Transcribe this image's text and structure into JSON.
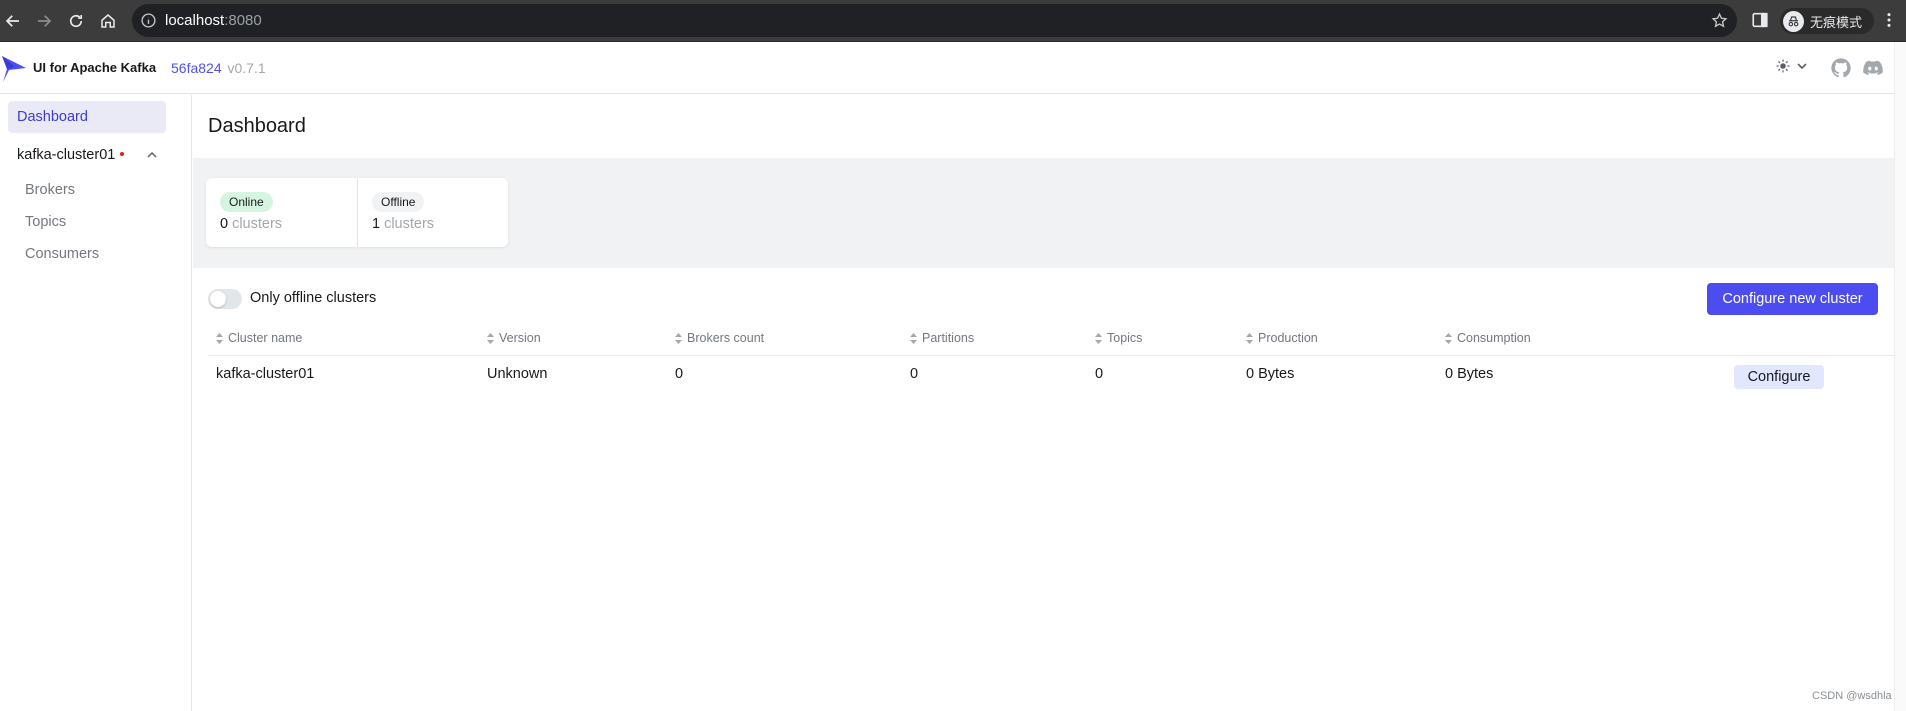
{
  "browser": {
    "url_host": "localhost",
    "url_port": ":8080",
    "profile_label": "无痕模式",
    "icons": [
      "back-icon",
      "forward-icon",
      "reload-icon",
      "home-icon",
      "site-info-icon",
      "bookmark-star-icon",
      "side-panel-icon",
      "incognito-icon",
      "menu-dots-icon"
    ]
  },
  "header": {
    "app_title": "UI for Apache Kafka",
    "commit": "56fa824",
    "version": "v0.7.1",
    "icons": [
      "logo-icon",
      "sun-icon",
      "chevron-down-icon",
      "github-icon",
      "discord-icon"
    ]
  },
  "sidebar": {
    "dashboard": "Dashboard",
    "cluster_name": "kafka-cluster01",
    "items": [
      {
        "label": "Brokers"
      },
      {
        "label": "Topics"
      },
      {
        "label": "Consumers"
      }
    ]
  },
  "main": {
    "title": "Dashboard",
    "metrics": [
      {
        "badge": "Online",
        "count": "0",
        "unit": "clusters",
        "badge_color": "#d6f5e0"
      },
      {
        "badge": "Offline",
        "count": "1",
        "unit": "clusters",
        "badge_color": "#f1f2f3"
      }
    ],
    "toggle_label": "Only offline clusters",
    "toggle_on": false,
    "configure_new": "Configure new cluster",
    "table": {
      "headers": [
        "Cluster name",
        "Version",
        "Brokers count",
        "Partitions",
        "Topics",
        "Production",
        "Consumption"
      ],
      "rows": [
        {
          "name": "kafka-cluster01",
          "version": "Unknown",
          "brokers": "0",
          "partitions": "0",
          "topics": "0",
          "production": "0 Bytes",
          "consumption": "0 Bytes",
          "action": "Configure"
        }
      ]
    }
  },
  "watermark": "CSDN @wsdhla",
  "colors": {
    "accent": "#4c4cf0",
    "sidebar_active_bg": "#eaeaf7",
    "offline_dot": "#e51a1a"
  }
}
